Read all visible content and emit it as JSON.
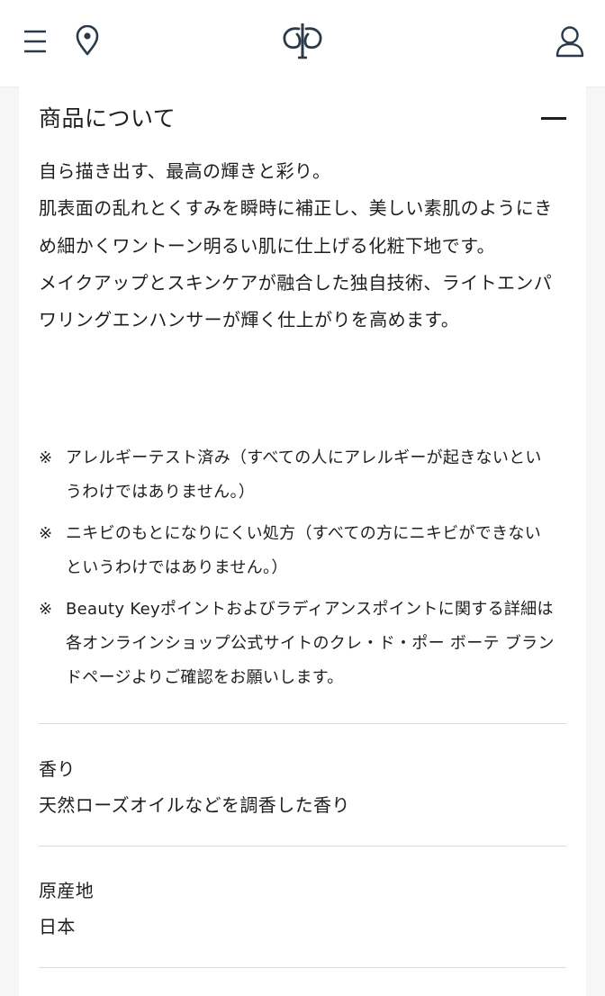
{
  "header": {
    "menu_icon": "hamburger-menu-icon",
    "store_icon": "location-pin-icon",
    "logo_icon": "cle-de-peau-logo-icon",
    "account_icon": "user-icon"
  },
  "section": {
    "title": "商品について",
    "toggle_icon": "minus-icon",
    "description": [
      "自ら描き出す、最高の輝きと彩り。",
      "肌表面の乱れとくすみを瞬時に補正し、美しい素肌のようにきめ細かくワントーン明るい肌に仕上げる化粧下地です。",
      "メイクアップとスキンケアが融合した独自技術、ライトエンパワリングエンハンサーが輝く仕上がりを高めます。"
    ],
    "notes": [
      {
        "mark": "※",
        "text": "アレルギーテスト済み（すべての人にアレルギーが起きないというわけではありません。）"
      },
      {
        "mark": "※",
        "text": "ニキビのもとになりにくい処方（すべての方にニキビができないというわけではありません。）"
      },
      {
        "mark": "※",
        "text": "Beauty Keyポイントおよびラディアンスポイントに関する詳細は各オンラインショップ公式サイトのクレ・ド・ポー ボーテ ブランドページよりご確認をお願いします。"
      }
    ]
  },
  "attributes": [
    {
      "label": "香り",
      "value": "天然ローズオイルなどを調香した香り"
    },
    {
      "label": "原産地",
      "value": "日本"
    }
  ],
  "colors": {
    "text": "#1e1e1e",
    "background": "#f6f6f6",
    "panel": "#ffffff",
    "divider": "#dcdcdc",
    "icon": "#2a3a4a"
  }
}
